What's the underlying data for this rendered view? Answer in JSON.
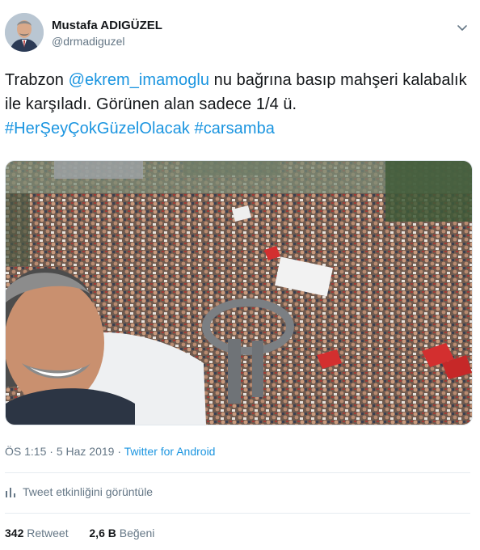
{
  "author": {
    "display_name": "Mustafa ADIGÜZEL",
    "handle": "@drmadiguzel"
  },
  "tweet": {
    "parts": [
      {
        "text": "Trabzon ",
        "link": false
      },
      {
        "text": "@ekrem_imamoglu",
        "link": true
      },
      {
        "text": " nu bağrına basıp mahşeri kalabalık ile karşıladı. Görünen alan sadece 1/4 ü.",
        "link": false
      }
    ],
    "hashtags": [
      "#HerŞeyÇokGüzelOlacak",
      "#carsamba"
    ]
  },
  "meta": {
    "time": "ÖS 1:15",
    "separator": " · ",
    "date": "5 Haz 2019",
    "source": "Twitter for Android"
  },
  "activity": {
    "label": "Tweet etkinliğini görüntüle"
  },
  "stats": {
    "retweets_count": "342",
    "retweets_label": "Retweet",
    "likes_count": "2,6 B",
    "likes_label": "Beğeni"
  },
  "icons": {
    "chevron": "chevron-down-icon",
    "activity": "bar-chart-icon"
  },
  "colors": {
    "link": "#1b95e0",
    "secondary_text": "#657786",
    "primary_text": "#14171a"
  }
}
